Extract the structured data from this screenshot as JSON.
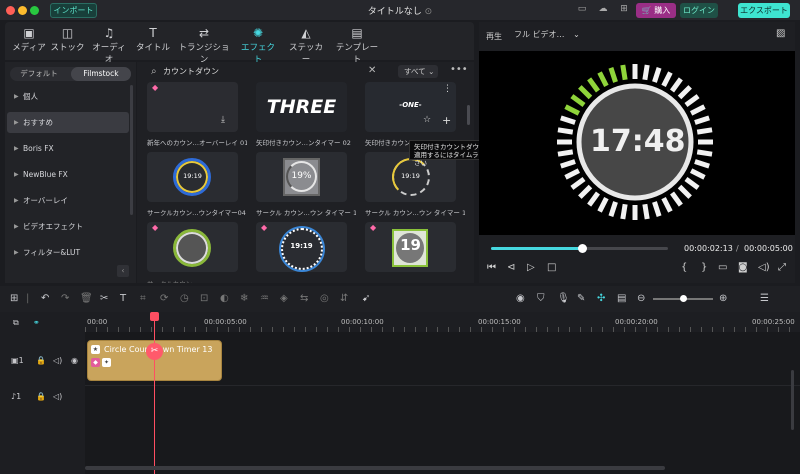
{
  "window": {
    "title": "タイトルなし",
    "import_label": "インポート",
    "purchase_label": "購入",
    "login_label": "ログイン",
    "export_label": "エクスポート"
  },
  "toolbar": {
    "tabs": [
      {
        "label": "メディア",
        "icon": "media-icon"
      },
      {
        "label": "ストック",
        "icon": "stock-icon"
      },
      {
        "label": "オーディオ",
        "icon": "music-note-icon"
      },
      {
        "label": "タイトル",
        "icon": "title-text-icon"
      },
      {
        "label": "トランジション",
        "icon": "transition-icon"
      },
      {
        "label": "エフェクト",
        "icon": "effect-sparkle-icon",
        "active": true
      },
      {
        "label": "ステッカー",
        "icon": "sticker-icon"
      },
      {
        "label": "テンプレート",
        "icon": "template-icon"
      }
    ]
  },
  "sidebar": {
    "tabs": [
      "デフォルト",
      "Filmstock"
    ],
    "active_tab": "Filmstock",
    "items": [
      {
        "label": "個人"
      },
      {
        "label": "おすすめ",
        "selected": true
      },
      {
        "label": "Boris FX"
      },
      {
        "label": "NewBlue FX"
      },
      {
        "label": "オーバーレイ"
      },
      {
        "label": "ビデオエフェクト"
      },
      {
        "label": "フィルター&LUT"
      }
    ]
  },
  "search": {
    "value": "カウントダウン",
    "filter_label": "すべて"
  },
  "grid": {
    "items": [
      {
        "caption": "新年へのカウン…オーバーレイ 01",
        "text": ""
      },
      {
        "caption": "矢印付きカウン…ンタイマー 02",
        "text": "THREE"
      },
      {
        "caption": "矢印付きカウン…",
        "text": "ONE"
      },
      {
        "caption": "サークルカウン…ウンタイマー04",
        "text": "19:19"
      },
      {
        "caption": "サークル カウン…ウン タイマー 14",
        "text": "19%"
      },
      {
        "caption": "サークル カウン…ウン タイマー 10",
        "text": "19:19"
      },
      {
        "caption": "",
        "text": ""
      },
      {
        "caption": "",
        "text": "19:19"
      },
      {
        "caption": "",
        "text": "19"
      }
    ]
  },
  "tooltip": {
    "line1": "矢印付きカウントダウンタイマー 01",
    "line2": "適用するにはタイムラインにドラッグしてください"
  },
  "preview": {
    "play_label": "再生",
    "quality": "フル ビデオ…",
    "timer_text": "17:48",
    "progress": 0.5,
    "current_time": "00:00:02:13",
    "separator": "/",
    "total_time": "00:00:05:00"
  },
  "timeline": {
    "ruler_labels": [
      "00:00",
      "00:00:05:00",
      "00:00:10:00",
      "00:00:15:00",
      "00:00:20:00",
      "00:00:25:00"
    ],
    "clip_title": "Circle Countdown Timer 13",
    "video_track_label": "1",
    "audio_track_label": "1"
  },
  "colors": {
    "accent": "#46d8e0",
    "clip": "#c9a45c",
    "playhead": "#ff4e62",
    "export": "#3ee4d0",
    "purchase": "#9a2e86",
    "timer_green": "#8fd43a"
  }
}
